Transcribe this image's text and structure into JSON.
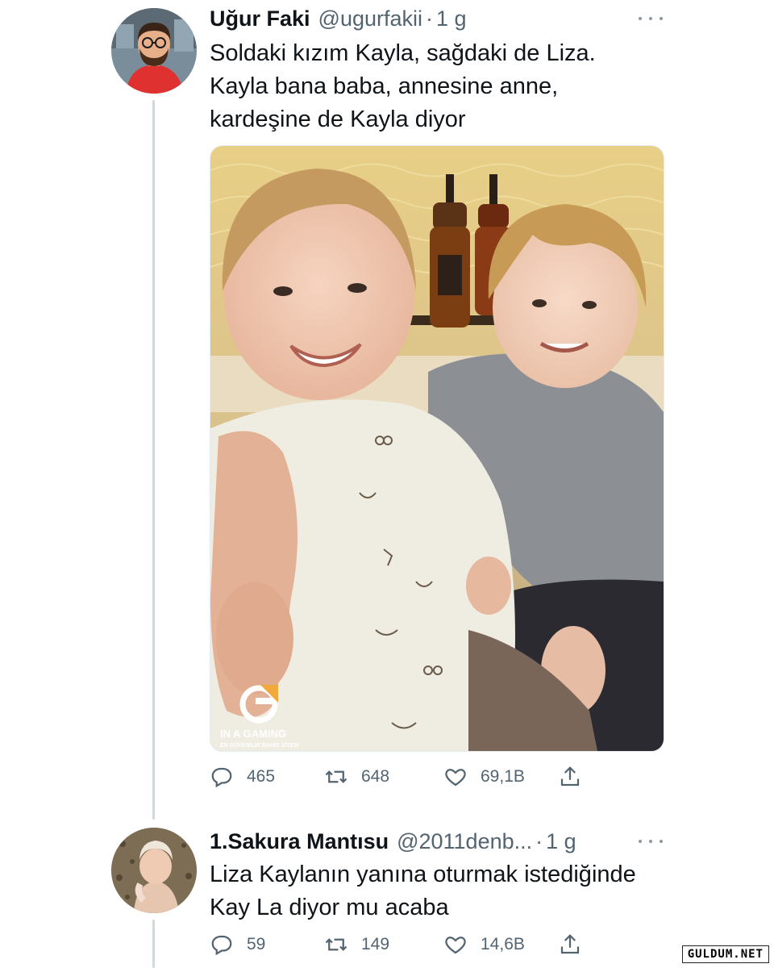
{
  "tweet": {
    "author_name": "Uğur Faki",
    "handle": "@ugurfakii",
    "separator": "·",
    "time": "1 g",
    "text_lines": [
      "Soldaki kızım Kayla, sağdaki de Liza.",
      "Kayla bana baba, annesine anne,",
      "kardeşine de Kayla diyor"
    ],
    "media": {
      "description_icon": "photo",
      "logo_text": "IN A GAMING",
      "logo_subtext": "EN GÜVENİLİR BAHİS SİTESİ"
    },
    "stats": {
      "replies": "465",
      "retweets": "648",
      "likes": "69,1B"
    }
  },
  "reply": {
    "author_name": "1.Sakura Mantısu",
    "handle": "@2011denb...",
    "separator": "·",
    "time": "1 g",
    "text_lines": [
      "Liza Kaylanın yanına oturmak istediğinde",
      "Kay La diyor mu acaba"
    ],
    "stats": {
      "replies": "59",
      "retweets": "149",
      "likes": "14,6B"
    }
  },
  "watermark": "GULDUM.NET",
  "colors": {
    "text": "#0f1419",
    "secondary": "#536471",
    "thread_line": "#cfd9de"
  },
  "icons": [
    "reply-icon",
    "retweet-icon",
    "like-icon",
    "share-icon",
    "more-icon"
  ]
}
